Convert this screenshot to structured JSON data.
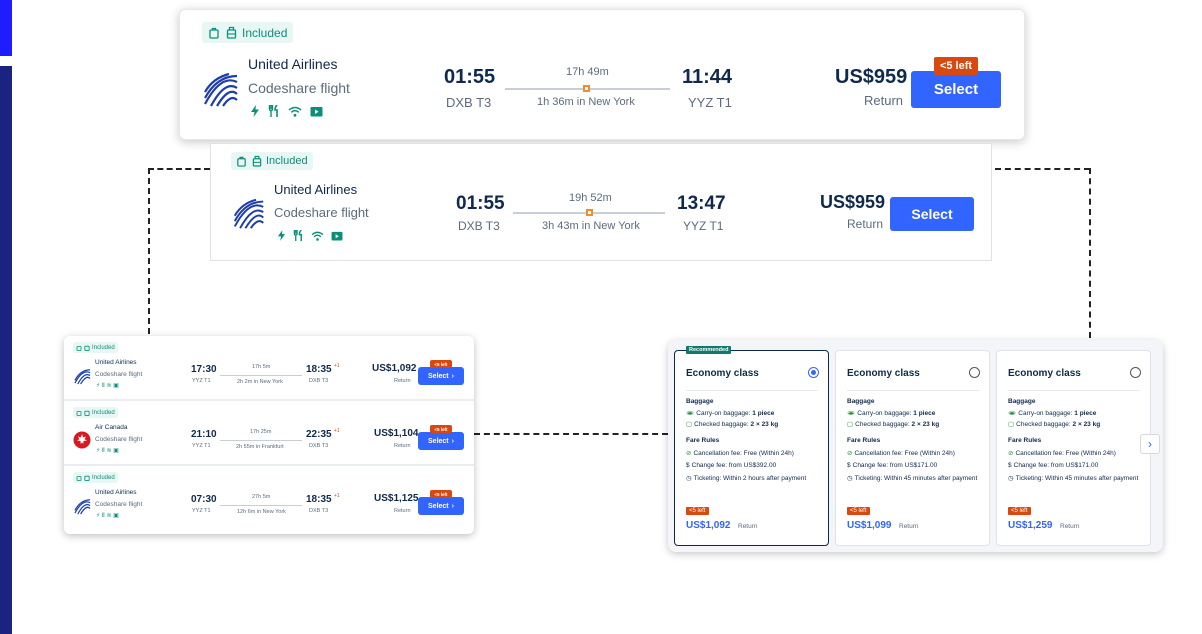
{
  "accent": "#3264ff",
  "warning_color": "#d9480f",
  "card_big": {
    "included": "Included",
    "airline": "United Airlines",
    "codeshare": "Codeshare flight",
    "depart_time": "01:55",
    "depart_airport": "DXB T3",
    "duration": "17h 49m",
    "layover": "1h 36m in New York",
    "arrive_time": "11:44",
    "arrive_airport": "YYZ T1",
    "price": "US$959",
    "price_note": "Return",
    "seats_left": "<5 left",
    "select": "Select"
  },
  "card_mid": {
    "included": "Included",
    "airline": "United Airlines",
    "codeshare": "Codeshare flight",
    "depart_time": "01:55",
    "depart_airport": "DXB T3",
    "duration": "19h 52m",
    "layover": "3h 43m in New York",
    "arrive_time": "13:47",
    "arrive_airport": "YYZ T1",
    "price": "US$959",
    "price_note": "Return",
    "select": "Select"
  },
  "list": [
    {
      "included": "Included",
      "airline": "United Airlines",
      "codeshare": "Codeshare flight",
      "depart_time": "17:30",
      "depart_airport": "YYZ T1",
      "duration": "17h 5m",
      "layover": "2h 2m in New York",
      "arrive_time": "18:35",
      "plus_day": "+1",
      "arrive_airport": "DXB T3",
      "price": "US$1,092",
      "price_note": "Return",
      "seats_left": "<5 left",
      "select": "Select"
    },
    {
      "included": "Included",
      "airline": "Air Canada",
      "codeshare": "Codeshare flight",
      "depart_time": "21:10",
      "depart_airport": "YYZ T1",
      "duration": "17h 25m",
      "layover": "2h 55m in Frankfurt",
      "arrive_time": "22:35",
      "plus_day": "+1",
      "arrive_airport": "DXB T3",
      "price": "US$1,104",
      "price_note": "Return",
      "seats_left": "<5 left",
      "select": "Select"
    },
    {
      "included": "Included",
      "airline": "United Airlines",
      "codeshare": "Codeshare flight",
      "depart_time": "07:30",
      "depart_airport": "YYZ T1",
      "duration": "27h 5m",
      "layover": "12h 6m in New York",
      "arrive_time": "18:35",
      "plus_day": "+1",
      "arrive_airport": "DXB T3",
      "price": "US$1,125",
      "price_note": "Return",
      "seats_left": "<5 left",
      "select": "Select"
    }
  ],
  "fares": [
    {
      "recommended": "Recommended",
      "title": "Economy class",
      "selected": true,
      "baggage_h": "Baggage",
      "carry_label": "Carry-on baggage:",
      "carry_val": "1 piece",
      "checked_label": "Checked baggage:",
      "checked_val": "2 × 23 kg",
      "rules_h": "Fare Rules",
      "cancel": "Cancellation fee: Free (Within 24h)",
      "change": "Change fee: from US$392.00",
      "ticketing": "Ticketing: Within 2 hours after payment",
      "seats_left": "<5 left",
      "price": "US$1,092",
      "price_note": "Return"
    },
    {
      "title": "Economy class",
      "selected": false,
      "baggage_h": "Baggage",
      "carry_label": "Carry-on baggage:",
      "carry_val": "1 piece",
      "checked_label": "Checked baggage:",
      "checked_val": "2 × 23 kg",
      "rules_h": "Fare Rules",
      "cancel": "Cancellation fee: Free (Within 24h)",
      "change": "Change fee: from US$171.00",
      "ticketing": "Ticketing: Within 45 minutes after payment",
      "seats_left": "<5 left",
      "price": "US$1,099",
      "price_note": "Return"
    },
    {
      "title": "Economy class",
      "selected": false,
      "baggage_h": "Baggage",
      "carry_label": "Carry-on baggage:",
      "carry_val": "1 piece",
      "checked_label": "Checked baggage:",
      "checked_val": "2 × 23 kg",
      "rules_h": "Fare Rules",
      "cancel": "Cancellation fee: Free (Within 24h)",
      "change": "Change fee: from US$171.00",
      "ticketing": "Ticketing: Within 45 minutes after payment",
      "seats_left": "<5 left",
      "price": "US$1,259",
      "price_note": "Return"
    }
  ]
}
